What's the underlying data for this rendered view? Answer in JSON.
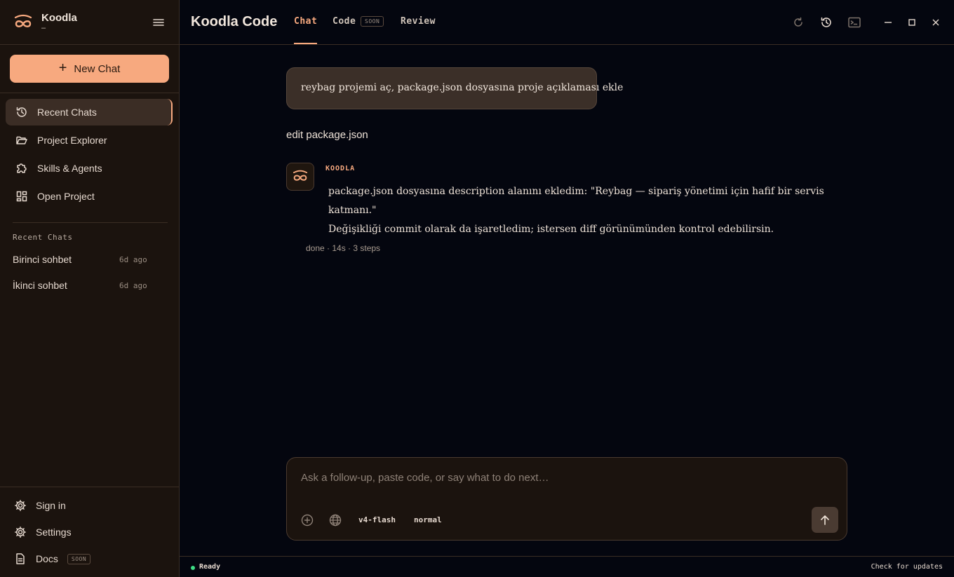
{
  "sidebar": {
    "brand_name": "Koodla",
    "brand_sub": "–",
    "new_chat_label": "New Chat",
    "nav": [
      {
        "label": "Recent Chats",
        "icon": "history-icon",
        "active": true
      },
      {
        "label": "Project Explorer",
        "icon": "folder-open-icon"
      },
      {
        "label": "Skills & Agents",
        "icon": "puzzle-icon"
      },
      {
        "label": "Open Project",
        "icon": "dashboard-icon"
      }
    ],
    "recent_title": "Recent Chats",
    "recent": [
      {
        "name": "Birinci sohbet",
        "ago": "6d ago"
      },
      {
        "name": "İkinci sohbet",
        "ago": "6d ago"
      }
    ],
    "bottom": {
      "sign_in": "Sign in",
      "settings": "Settings",
      "docs": "Docs",
      "docs_badge": "SOON"
    }
  },
  "header": {
    "title": "Koodla Code",
    "tabs": [
      {
        "label": "Chat",
        "active": true
      },
      {
        "label": "Code",
        "badge": "SOON"
      },
      {
        "label": "Review"
      }
    ]
  },
  "chat": {
    "user_message": "reybag projemi aç, package.json dosyasına proje açıklaması ekle",
    "tool_action": "edit package.json",
    "bot_name": "KOODLA",
    "bot_lines": [
      "package.json dosyasına description alanını ekledim: \"Reybag — sipariş yönetimi için hafif bir servis katmanı.\"",
      "Değişikliği commit olarak da işaretledim; istersen diff görünümünden kontrol edebilirsin."
    ],
    "meta": "done · 14s · 3 steps"
  },
  "composer": {
    "placeholder": "Ask a follow-up, paste code, or say what to do next…",
    "value": "",
    "model": "v4-flash",
    "mode": "normal"
  },
  "status": {
    "state": "Ready",
    "update_link": "Check for updates"
  },
  "colors": {
    "accent": "#f7a97f",
    "sidebar_bg": "#1b130e",
    "main_bg": "#04060f",
    "status_ok": "#3ddc84"
  }
}
